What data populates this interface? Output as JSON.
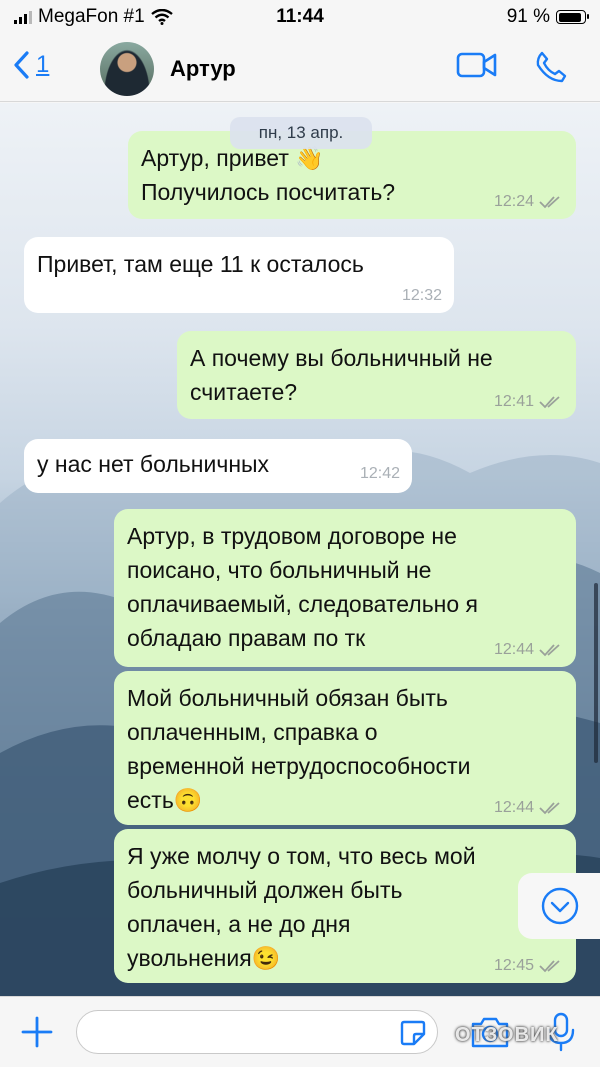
{
  "status_bar": {
    "carrier": "MegaFon #1",
    "time": "11:44",
    "battery": "91 %",
    "battery_level": 0.91
  },
  "header": {
    "back_count": "1",
    "contact_name": "Артур"
  },
  "chat": {
    "date_label": "пн, 13 апр.",
    "messages": [
      {
        "dir": "out",
        "lines": [
          "Артур, привет 👋",
          "Получилось посчитать?"
        ],
        "time": "12:24",
        "read": true
      },
      {
        "dir": "in",
        "lines": [
          "Привет, там еще 11 к осталось"
        ],
        "time": "12:32"
      },
      {
        "dir": "out",
        "lines": [
          "А почему вы больничный не",
          "считаете?"
        ],
        "time": "12:41",
        "read": true
      },
      {
        "dir": "in",
        "lines": [
          "у нас нет больничных"
        ],
        "time": "12:42"
      },
      {
        "dir": "out",
        "lines": [
          "Артур, в трудовом договоре не",
          "поисано, что больничный не",
          "оплачиваемый, следовательно я",
          "обладаю правам по тк"
        ],
        "time": "12:44",
        "read": true
      },
      {
        "dir": "out",
        "lines": [
          "Мой больничный обязан быть",
          "оплаченным, справка о",
          "временной нетрудоспособности",
          "есть🙃"
        ],
        "time": "12:44",
        "read": true
      },
      {
        "dir": "out",
        "lines": [
          "Я уже молчу о том, что весь мой",
          "больничный должен быть",
          "оплачен, а не до дня",
          "увольнения😉"
        ],
        "time": "12:45",
        "read": true
      }
    ]
  },
  "input_bar": {
    "placeholder": ""
  },
  "watermark": "ОТЗОВИК",
  "colors": {
    "accent": "#1a7cf6",
    "out_bubble": "#dcf8c6",
    "in_bubble": "#ffffff"
  }
}
